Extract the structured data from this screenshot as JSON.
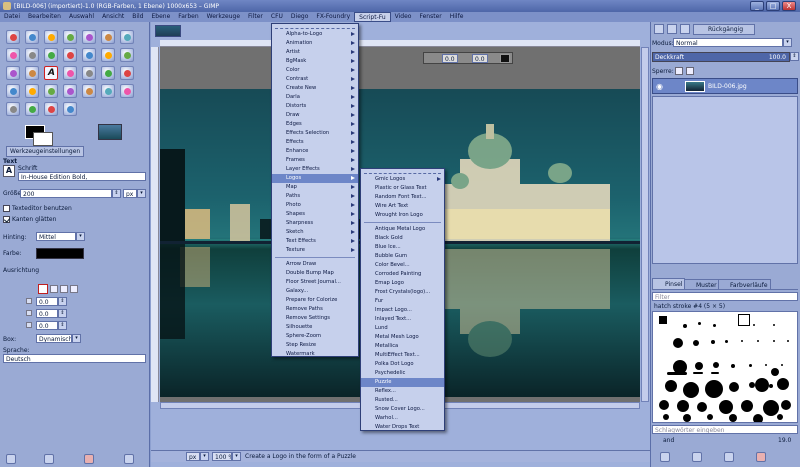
{
  "window": {
    "title": "[BILD-006] (importiert)-1.0 (RGB-Farben, 1 Ebene) 1000x653 – GIMP",
    "buttons": [
      "_",
      "□",
      "X"
    ]
  },
  "menubar": [
    "Datei",
    "Bearbeiten",
    "Auswahl",
    "Ansicht",
    "Bild",
    "Ebene",
    "Farben",
    "Werkzeuge",
    "Filter",
    "CFU",
    "Diego",
    "FX-Foundry",
    "Script-Fu",
    "Video",
    "Fenster",
    "Hilfe"
  ],
  "menubar_open": "Script-Fu",
  "toolbox": {
    "tab_label": "Werkzeugeinstellungen",
    "section": "Text",
    "font_label": "Schrift",
    "font_value": "In-House Edition Bold,",
    "size_label": "Größe:",
    "size_value": "200",
    "size_unit": "px",
    "use_editor": "Texteditor benutzen",
    "antialias": "Kanten glätten",
    "hinting_label": "Hinting:",
    "hinting_value": "Mittel",
    "color_label": "Farbe:",
    "justify_label": "Ausrichtung",
    "indent_value": "0.0",
    "linespacing_value": "0.0",
    "letterspacing_value": "0.0",
    "box_label": "Box:",
    "box_value": "Dynamisch",
    "language_label": "Sprache:",
    "language_value": "Deutsch"
  },
  "canvas": {
    "text_offset_x": "0.0",
    "text_offset_y": "0.0",
    "zoom": "100 %",
    "unit": "px",
    "status": "Create a Logo in the form of a Puzzle"
  },
  "script_fu_menu": {
    "items": [
      {
        "label": "Alpha-to-Logo",
        "sub": true
      },
      {
        "label": "Animation",
        "sub": true
      },
      {
        "label": "Artist",
        "sub": true
      },
      {
        "label": "BgMask",
        "sub": true
      },
      {
        "label": "Color",
        "sub": true
      },
      {
        "label": "Contrast",
        "sub": true
      },
      {
        "label": "Create New",
        "sub": true
      },
      {
        "label": "Darla",
        "sub": true
      },
      {
        "label": "Distorts",
        "sub": true
      },
      {
        "label": "Draw",
        "sub": true
      },
      {
        "label": "Edges",
        "sub": true
      },
      {
        "label": "Effects Selection",
        "sub": true
      },
      {
        "label": "Effects",
        "sub": true
      },
      {
        "label": "Enhance",
        "sub": true
      },
      {
        "label": "Frames",
        "sub": true
      },
      {
        "label": "Layer Effects",
        "sub": true
      },
      {
        "label": "Logos",
        "sub": true,
        "hl": true
      },
      {
        "label": "Map",
        "sub": true
      },
      {
        "label": "Paths",
        "sub": true
      },
      {
        "label": "Photo",
        "sub": true
      },
      {
        "label": "Shapes",
        "sub": true
      },
      {
        "label": "Sharpness",
        "sub": true
      },
      {
        "label": "Sketch",
        "sub": true
      },
      {
        "label": "Text Effects",
        "sub": true
      },
      {
        "label": "Texture",
        "sub": true
      },
      {
        "sep": true
      },
      {
        "label": "Arrow Draw"
      },
      {
        "label": "Double Bump Map"
      },
      {
        "label": "Floor Street Journal..."
      },
      {
        "label": "Galaxy..."
      },
      {
        "label": "Prepare for Colorize"
      },
      {
        "label": "Remove Paths"
      },
      {
        "label": "Remove Settings"
      },
      {
        "label": "Silhouette"
      },
      {
        "label": "Sphere-Zoom"
      },
      {
        "label": "Step Resize"
      },
      {
        "label": "Watermark"
      }
    ]
  },
  "logos_menu": {
    "items": [
      {
        "label": "Gmic Logos",
        "sub": true
      },
      {
        "label": "Plastic or Glass Text"
      },
      {
        "label": "Random Font Text..."
      },
      {
        "label": "Wire Art Text"
      },
      {
        "label": "Wrought Iron Logo"
      },
      {
        "sep": true
      },
      {
        "label": "Antique Metal Logo"
      },
      {
        "label": "Black Gold"
      },
      {
        "label": "Blue Ice..."
      },
      {
        "label": "Bubble Gum"
      },
      {
        "label": "Color Bevel..."
      },
      {
        "label": "Corroded Painting"
      },
      {
        "label": "Emap Logo"
      },
      {
        "label": "Frost Crystals(logo)..."
      },
      {
        "label": "Fur"
      },
      {
        "label": "Impact Logo..."
      },
      {
        "label": "Inlayed Text..."
      },
      {
        "label": "Lund"
      },
      {
        "label": "Metal Mesh Logo"
      },
      {
        "label": "Metallica"
      },
      {
        "label": "MultiEffect Text..."
      },
      {
        "label": "Polka Dot Logo"
      },
      {
        "label": "Psychedelic"
      },
      {
        "label": "Puzzle",
        "hl": true
      },
      {
        "label": "Reflex..."
      },
      {
        "label": "Rusted..."
      },
      {
        "label": "Snow Cover Logo..."
      },
      {
        "label": "Warhol..."
      },
      {
        "label": "Water Drops Text"
      }
    ]
  },
  "layers_dock": {
    "undo_tab": "Rückgängig",
    "mode_label": "Modus:",
    "mode_value": "Normal",
    "opacity_label": "Deckkraft",
    "opacity_value": "100.0",
    "lock_label": "Sperre:",
    "layer_name": "BILD-006.jpg"
  },
  "brushes_dock": {
    "tabs": [
      "Pinsel",
      "Muster",
      "Farbverläufe"
    ],
    "filter_placeholder": "Filter",
    "brush_name": "hatch stroke #4 (5 × 5)",
    "tag_placeholder": "Schlagwörter eingeben",
    "spacing_label": "and",
    "spacing_value": "19.0"
  },
  "colors": {
    "accent": "#6d86c8",
    "fg": "#000000",
    "bg": "#ffffff",
    "selection_red": "#d02020"
  }
}
